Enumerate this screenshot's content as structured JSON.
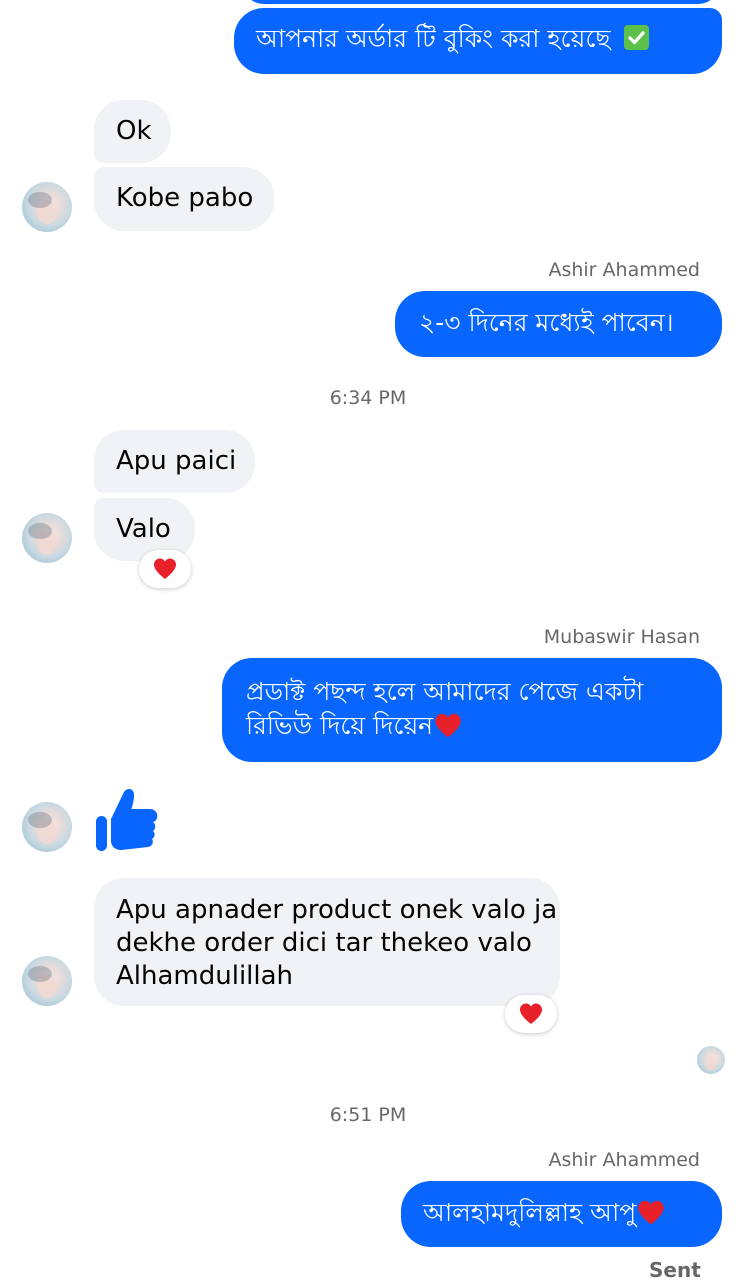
{
  "colors": {
    "outgoing_bubble": "#0866ff",
    "incoming_bubble": "#f0f2f5",
    "meta_text": "#65676b",
    "heart": "#e8202a",
    "like": "#0866ff"
  },
  "messages": {
    "m1": {
      "text": "আপনার অর্ডার টি বুকিং করা হয়েছে",
      "emoji": "✅"
    },
    "m2": {
      "text": "Ok"
    },
    "m3": {
      "text": "Kobe pabo"
    },
    "sender1": "Ashir Ahammed",
    "m4": {
      "text": "২-৩ দিনের মধ্যেই পাবেন।"
    },
    "time1": "6:34 PM",
    "m5": {
      "text": "Apu paici"
    },
    "m6": {
      "text": "Valo",
      "reaction": "heart-icon"
    },
    "sender2": "Mubaswir Hasan",
    "m7": {
      "line1": "প্রডাক্ট পছন্দ হলে আমাদের পেজে একটা",
      "line2": "রিভিউ দিয়ে দিয়েন",
      "emoji": "heart"
    },
    "m8": {
      "icon": "thumbs-up-icon"
    },
    "m9": {
      "line1": "Apu apnader product onek valo ja",
      "line2": "dekhe order dici tar thekeo valo",
      "line3": "Alhamdulillah",
      "reaction": "heart-icon"
    },
    "time2": "6:51 PM",
    "sender3": "Ashir Ahammed",
    "m10": {
      "text": "আলহামদুলিল্লাহ আপু",
      "emoji": "heart"
    },
    "status": "Sent"
  }
}
